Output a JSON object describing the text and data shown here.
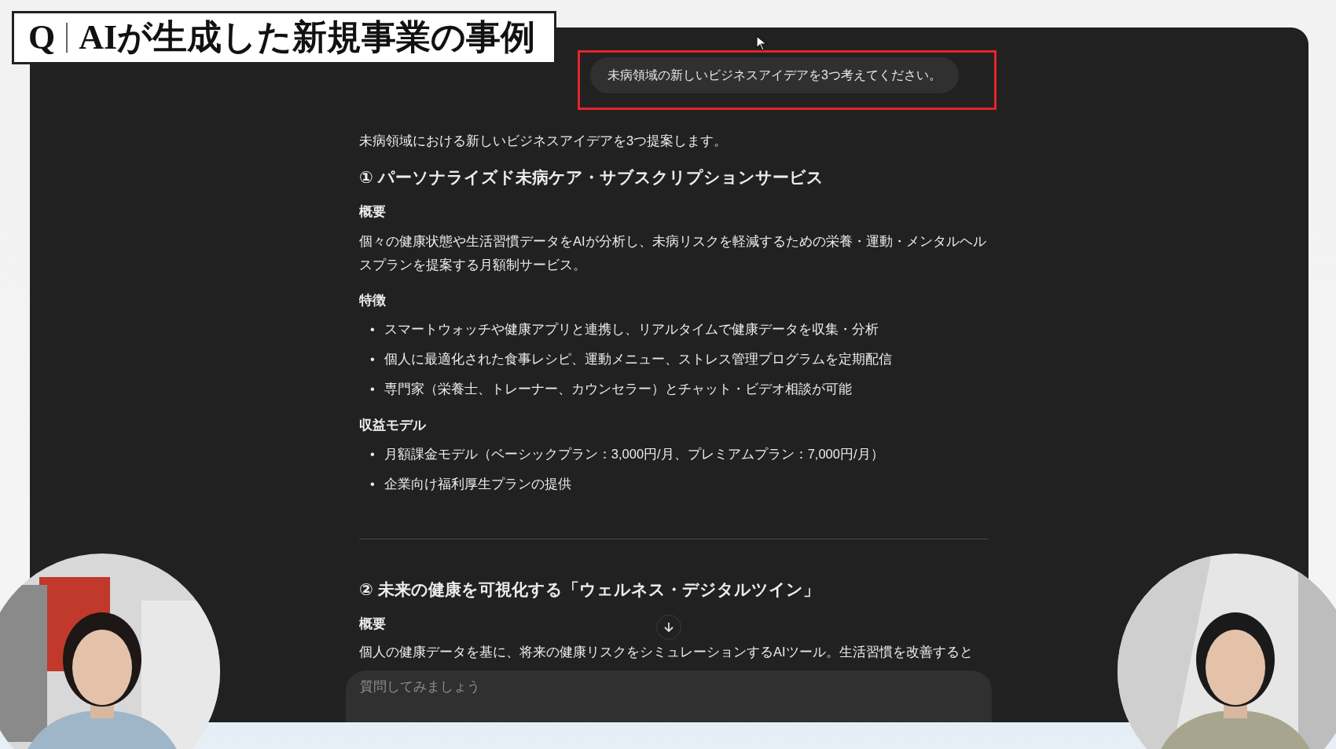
{
  "title_banner": {
    "prefix": "Q",
    "text": "AIが生成した新規事業の事例"
  },
  "prompt": {
    "text": "未病領域の新しいビジネスアイデアを3つ考えてください。",
    "highlighted": true
  },
  "response": {
    "intro": "未病領域における新しいビジネスアイデアを3つ提案します。",
    "sections": [
      {
        "heading": "① パーソナライズド未病ケア・サブスクリプションサービス",
        "blocks": [
          {
            "kind": "label",
            "text": "概要"
          },
          {
            "kind": "paragraph",
            "text": "個々の健康状態や生活習慣データをAIが分析し、未病リスクを軽減するための栄養・運動・メンタルヘルスプランを提案する月額制サービス。"
          },
          {
            "kind": "label",
            "text": "特徴"
          },
          {
            "kind": "bullets",
            "marker": "•",
            "items": [
              "スマートウォッチや健康アプリと連携し、リアルタイムで健康データを収集・分析",
              "個人に最適化された食事レシピ、運動メニュー、ストレス管理プログラムを定期配信",
              "専門家（栄養士、トレーナー、カウンセラー）とチャット・ビデオ相談が可能"
            ]
          },
          {
            "kind": "label",
            "text": "収益モデル"
          },
          {
            "kind": "bullets",
            "marker": "•",
            "items": [
              "月額課金モデル（ベーシックプラン：3,000円/月、プレミアムプラン：7,000円/月）",
              "企業向け福利厚生プランの提供"
            ]
          }
        ]
      },
      {
        "heading": "② 未来の健康を可視化する「ウェルネス・デジタルツイン」",
        "blocks": [
          {
            "kind": "label",
            "text": "概要"
          },
          {
            "kind": "paragraph",
            "text": "個人の健康データを基に、将来の健康リスクをシミュレーションするAIツール。生活習慣を改善すると"
          }
        ]
      }
    ]
  },
  "composer": {
    "placeholder": "質問してみましょう"
  }
}
